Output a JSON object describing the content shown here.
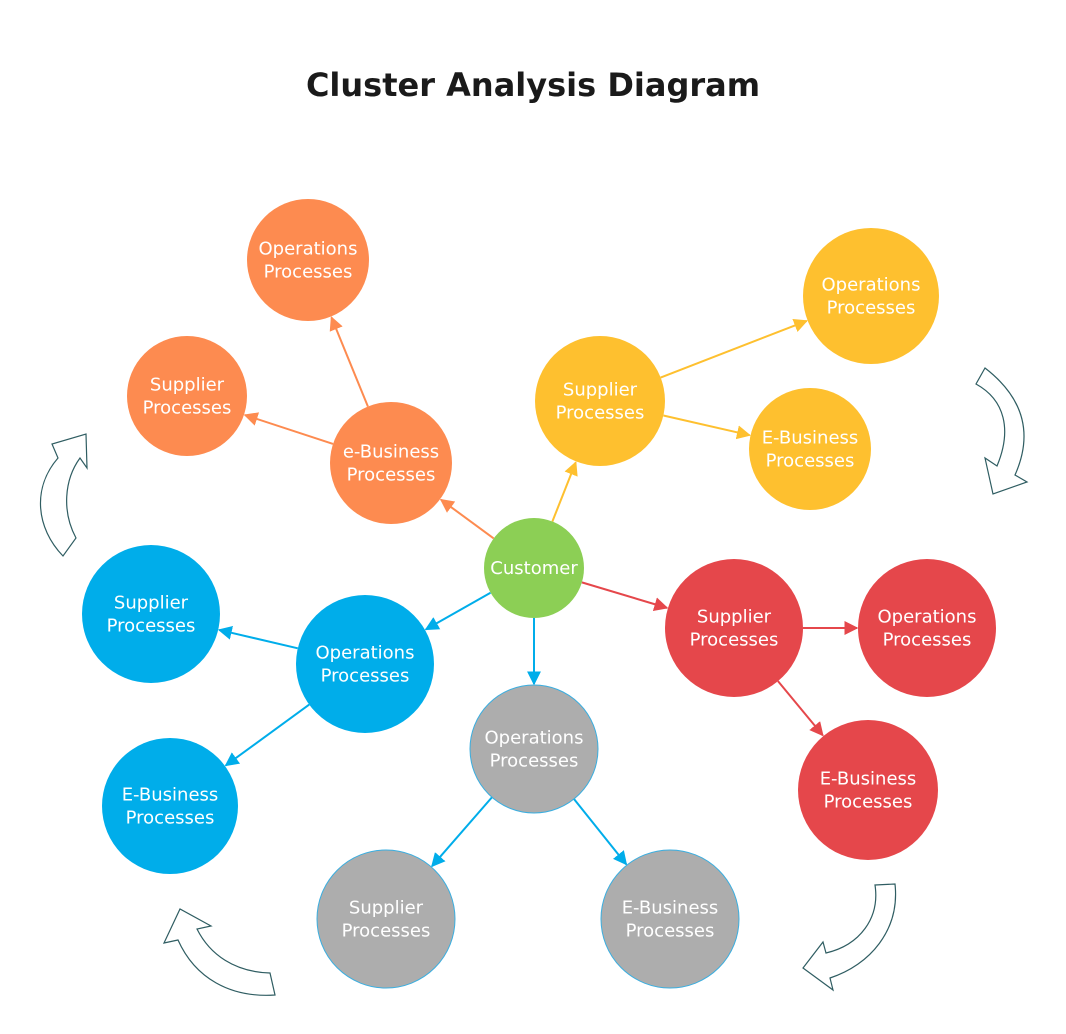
{
  "title": "Cluster Analysis Diagram",
  "colors": {
    "customer": "#8ccf55",
    "orange": "#fd8b50",
    "yellow": "#fec02f",
    "red": "#e5474b",
    "blue": "#00adea",
    "gray": "#adadad",
    "gray_stroke": "#3aaee0",
    "cycle_arrow_stroke": "#2f5d62",
    "label": "#ffffff"
  },
  "nodes": [
    {
      "id": "customer",
      "lines": [
        "Customer"
      ],
      "color": "customer"
    },
    {
      "id": "orange-ebusiness",
      "lines": [
        "e-Business",
        "Processes"
      ],
      "color": "orange"
    },
    {
      "id": "orange-operations",
      "lines": [
        "Operations",
        "Processes"
      ],
      "color": "orange"
    },
    {
      "id": "orange-supplier",
      "lines": [
        "Supplier",
        "Processes"
      ],
      "color": "orange"
    },
    {
      "id": "yellow-supplier",
      "lines": [
        "Supplier",
        "Processes"
      ],
      "color": "yellow"
    },
    {
      "id": "yellow-operations",
      "lines": [
        "Operations",
        "Processes"
      ],
      "color": "yellow"
    },
    {
      "id": "yellow-ebusiness",
      "lines": [
        "E-Business",
        "Processes"
      ],
      "color": "yellow"
    },
    {
      "id": "red-supplier",
      "lines": [
        "Supplier",
        "Processes"
      ],
      "color": "red"
    },
    {
      "id": "red-operations",
      "lines": [
        "Operations",
        "Processes"
      ],
      "color": "red"
    },
    {
      "id": "red-ebusiness",
      "lines": [
        "E-Business",
        "Processes"
      ],
      "color": "red"
    },
    {
      "id": "blue-operations",
      "lines": [
        "Operations",
        "Processes"
      ],
      "color": "blue"
    },
    {
      "id": "blue-supplier",
      "lines": [
        "Supplier",
        "Processes"
      ],
      "color": "blue"
    },
    {
      "id": "blue-ebusiness",
      "lines": [
        "E-Business",
        "Processes"
      ],
      "color": "blue"
    },
    {
      "id": "gray-operations",
      "lines": [
        "Operations",
        "Processes"
      ],
      "color": "gray"
    },
    {
      "id": "gray-supplier",
      "lines": [
        "Supplier",
        "Processes"
      ],
      "color": "gray"
    },
    {
      "id": "gray-ebusiness",
      "lines": [
        "E-Business",
        "Processes"
      ],
      "color": "gray"
    }
  ],
  "edges": [
    {
      "from": "customer",
      "to": "orange-ebusiness",
      "color": "orange"
    },
    {
      "from": "orange-ebusiness",
      "to": "orange-operations",
      "color": "orange"
    },
    {
      "from": "orange-ebusiness",
      "to": "orange-supplier",
      "color": "orange"
    },
    {
      "from": "customer",
      "to": "yellow-supplier",
      "color": "yellow"
    },
    {
      "from": "yellow-supplier",
      "to": "yellow-operations",
      "color": "yellow"
    },
    {
      "from": "yellow-supplier",
      "to": "yellow-ebusiness",
      "color": "yellow"
    },
    {
      "from": "customer",
      "to": "red-supplier",
      "color": "red"
    },
    {
      "from": "red-supplier",
      "to": "red-operations",
      "color": "red"
    },
    {
      "from": "red-supplier",
      "to": "red-ebusiness",
      "color": "red"
    },
    {
      "from": "customer",
      "to": "blue-operations",
      "color": "blue"
    },
    {
      "from": "blue-operations",
      "to": "blue-supplier",
      "color": "blue"
    },
    {
      "from": "blue-operations",
      "to": "blue-ebusiness",
      "color": "blue"
    },
    {
      "from": "customer",
      "to": "gray-operations",
      "color": "blue"
    },
    {
      "from": "gray-operations",
      "to": "gray-supplier",
      "color": "blue"
    },
    {
      "from": "gray-operations",
      "to": "gray-ebusiness",
      "color": "blue"
    }
  ],
  "cycle_arrows": [
    "top-left",
    "top-right",
    "bottom-right",
    "bottom-left"
  ]
}
